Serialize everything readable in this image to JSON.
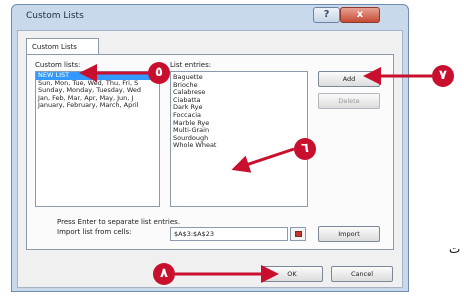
{
  "dialog": {
    "title": "Custom Lists",
    "help_glyph": "?",
    "close_glyph": "x"
  },
  "tab": {
    "label": "Custom Lists"
  },
  "custom_lists": {
    "label": "Custom lists:",
    "items": [
      "NEW LIST",
      "Sun, Mon, Tue, Wed, Thu, Fri, S",
      "Sunday, Monday, Tuesday, Wed",
      "Jan, Feb, Mar, Apr, May, Jun, J",
      "January, February, March, April"
    ]
  },
  "list_entries": {
    "label": "List entries:",
    "items": [
      "Baguette",
      "Brioche",
      "Calabrese",
      "Ciabatta",
      "Dark Rye",
      "Foccacia",
      "Marble Rye",
      "Multi-Grain",
      "Sourdough",
      "Whole Wheat"
    ]
  },
  "buttons": {
    "add": "Add",
    "delete": "Delete",
    "import": "Import",
    "ok": "OK",
    "cancel": "Cancel"
  },
  "import_section": {
    "hint": "Press Enter to separate list entries.",
    "import_label": "Import list from cells:",
    "range_value": "$A$3:$A$23"
  },
  "callouts": {
    "step_5": "٥",
    "step_6": "٦",
    "step_7": "٧",
    "step_8": "٨",
    "color": "#c8102e"
  },
  "side_text": "ت"
}
